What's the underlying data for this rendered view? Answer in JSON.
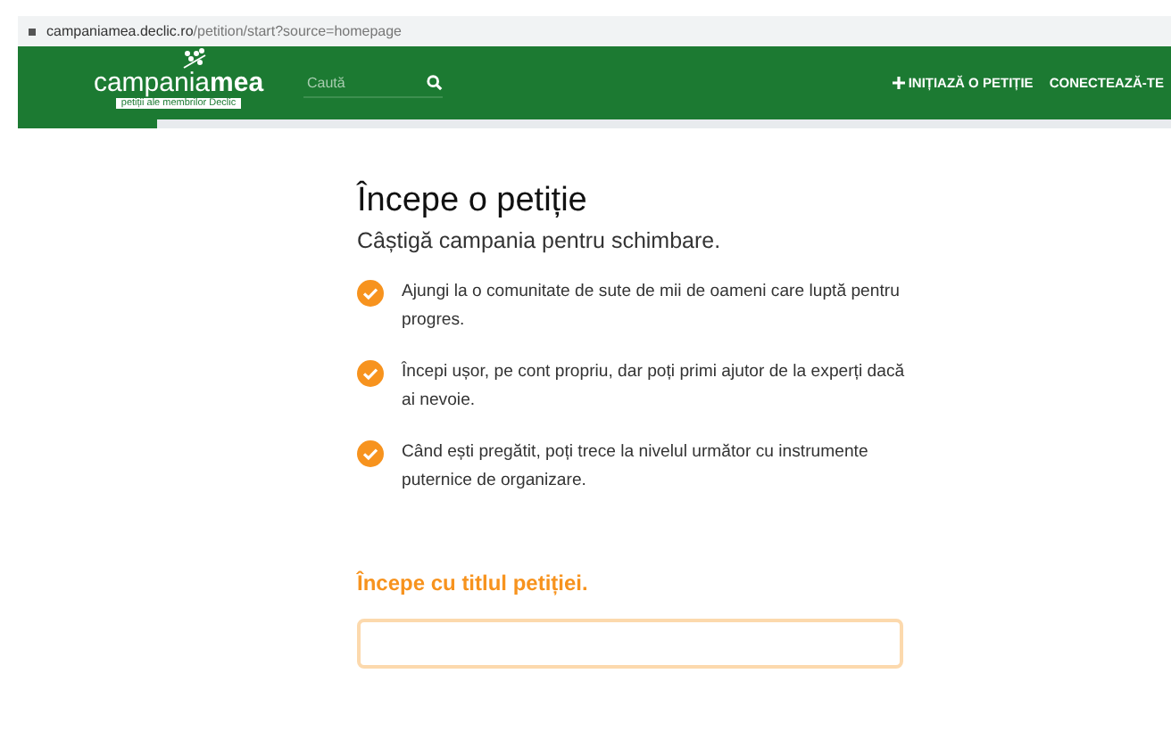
{
  "address_bar": {
    "host": "campaniamea.declic.ro",
    "path": "/petition/start?source=homepage"
  },
  "header": {
    "logo": {
      "text": "campania**mea**",
      "tagline": "petiții ale membrilor Declic"
    },
    "search": {
      "placeholder": "Caută"
    },
    "nav": [
      {
        "label": "INIȚIAZĂ O PETIȚIE",
        "kind": "add"
      },
      {
        "label": "CONECTEAZĂ-TE",
        "kind": "plain"
      }
    ]
  },
  "progress": {
    "level": 0.12
  },
  "main": {
    "title": "Începe o petiție",
    "subtitle": "Câștigă campania pentru schimbare.",
    "benefits": [
      "Ajungi la o comunitate de sute de mii de oameni care luptă pentru progres.",
      "Începi ușor, pe cont propriu, dar poți primi ajutor de la experți dacă ai nevoie.",
      "Când ești pregătit, poți trece la nivelul următor cu instrumente puternice de organizare."
    ],
    "prompt": "Începe cu titlul petiției."
  }
}
